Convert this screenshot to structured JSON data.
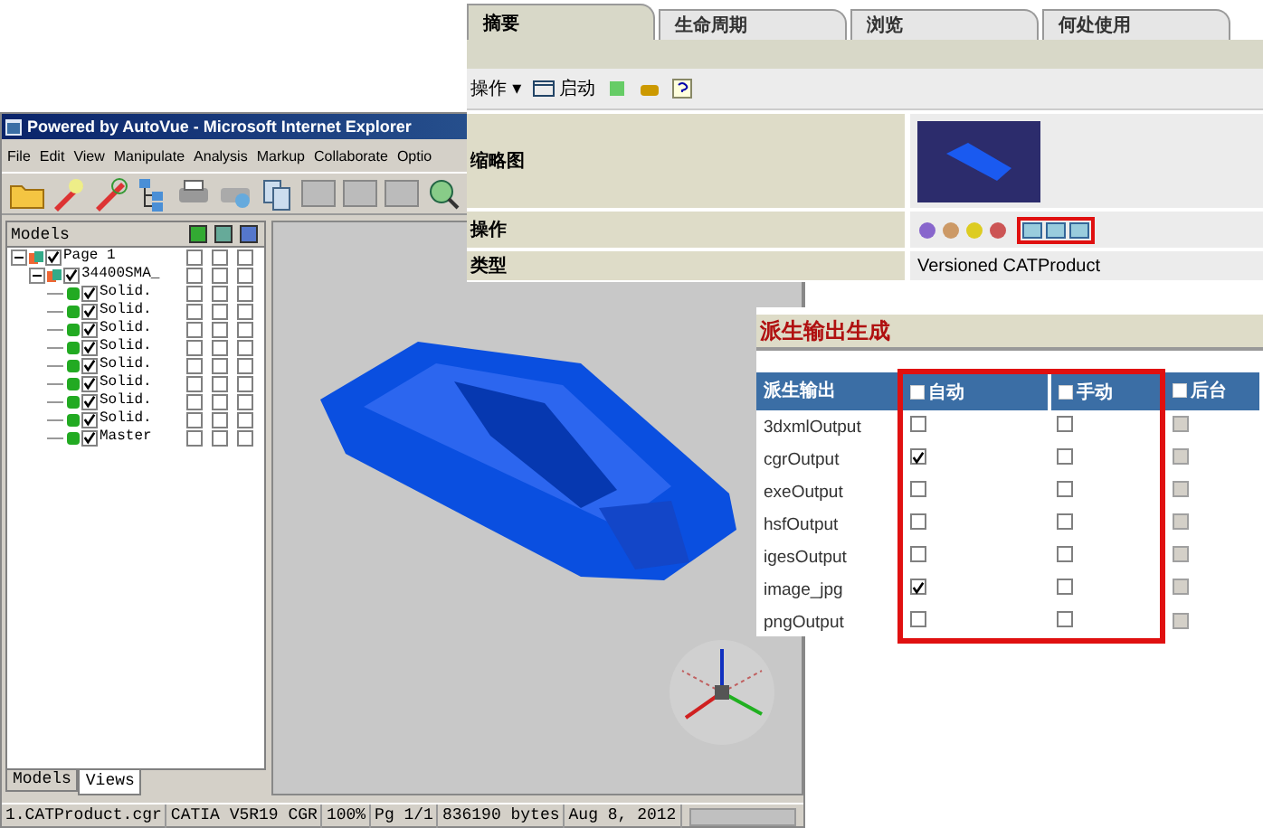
{
  "viewer": {
    "title": "Powered by AutoVue - Microsoft Internet Explorer",
    "menu": [
      "File",
      "Edit",
      "View",
      "Manipulate",
      "Analysis",
      "Markup",
      "Collaborate",
      "Optio"
    ],
    "tree": {
      "header": "Models",
      "items": [
        {
          "label": "Page 1",
          "checked": true,
          "expanded": true,
          "flags": [
            false,
            false,
            false
          ],
          "children": [
            {
              "label": "34400SMA_",
              "checked": true,
              "expanded": true,
              "flags": [
                false,
                false,
                false
              ],
              "children": [
                {
                  "label": "Solid.",
                  "checked": true,
                  "flags": [
                    false,
                    false,
                    false
                  ]
                },
                {
                  "label": "Solid.",
                  "checked": true,
                  "flags": [
                    false,
                    false,
                    false
                  ]
                },
                {
                  "label": "Solid.",
                  "checked": true,
                  "flags": [
                    false,
                    false,
                    false
                  ]
                },
                {
                  "label": "Solid.",
                  "checked": true,
                  "flags": [
                    false,
                    false,
                    false
                  ]
                },
                {
                  "label": "Solid.",
                  "checked": true,
                  "flags": [
                    false,
                    false,
                    false
                  ]
                },
                {
                  "label": "Solid.",
                  "checked": true,
                  "flags": [
                    false,
                    false,
                    false
                  ]
                },
                {
                  "label": "Solid.",
                  "checked": true,
                  "flags": [
                    false,
                    false,
                    false
                  ]
                },
                {
                  "label": "Solid.",
                  "checked": true,
                  "flags": [
                    false,
                    false,
                    false
                  ]
                },
                {
                  "label": "Master",
                  "checked": true,
                  "flags": [
                    false,
                    false,
                    false
                  ]
                }
              ]
            }
          ]
        }
      ]
    },
    "panel_tabs": [
      {
        "label": "Models",
        "selected": false
      },
      {
        "label": "Views",
        "selected": true
      }
    ],
    "status_bar": [
      "1.CATProduct.cgr",
      "CATIA V5R19 CGR",
      "100%",
      "Pg 1/1",
      "836190 bytes",
      "Aug 8, 2012"
    ]
  },
  "properties": {
    "tabs": [
      {
        "label": "摘要",
        "selected": true
      },
      {
        "label": "生命周期",
        "selected": false
      },
      {
        "label": "浏览",
        "selected": false
      },
      {
        "label": "何处使用",
        "selected": false
      }
    ],
    "toolbar": {
      "menu": "操作 ▾",
      "launch": "启动"
    },
    "rows": [
      {
        "kind": "thumbnail",
        "label": "缩略图"
      },
      {
        "kind": "actions",
        "label": "操作",
        "highlighted": true
      },
      {
        "kind": "text",
        "label": "类型",
        "value": "Versioned CATProduct"
      }
    ]
  },
  "derived_outputs": {
    "title": "派生输出生成",
    "columns": [
      {
        "label": "派生输出",
        "highlighted": false
      },
      {
        "label": "自动",
        "highlighted": true
      },
      {
        "label": "手动",
        "highlighted": true
      },
      {
        "label": "后台",
        "highlighted": false
      }
    ],
    "rows": [
      {
        "name": "3dxmlOutput",
        "auto": false,
        "manual": false,
        "background_disabled": true
      },
      {
        "name": "cgrOutput",
        "auto": true,
        "manual": false,
        "background_disabled": true
      },
      {
        "name": "exeOutput",
        "auto": false,
        "manual": false,
        "background_disabled": true
      },
      {
        "name": "hsfOutput",
        "auto": false,
        "manual": false,
        "background_disabled": true
      },
      {
        "name": "igesOutput",
        "auto": false,
        "manual": false,
        "background_disabled": true
      },
      {
        "name": "image_jpg",
        "auto": true,
        "manual": false,
        "background_disabled": true
      },
      {
        "name": "pngOutput",
        "auto": false,
        "manual": false,
        "background_disabled": true
      }
    ]
  }
}
